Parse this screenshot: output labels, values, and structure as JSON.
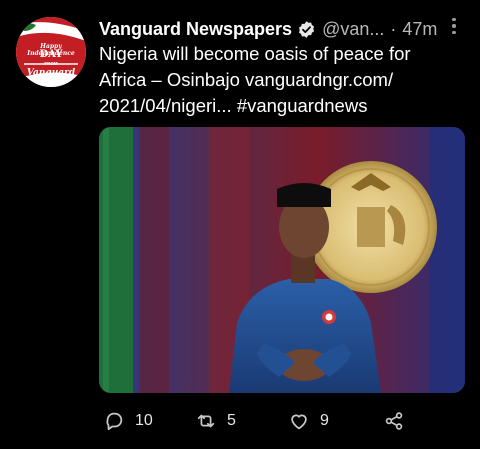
{
  "tweet": {
    "author": {
      "display_name": "Vanguard Newspapers",
      "handle": "@van...",
      "verified": true,
      "avatar": {
        "greeting": "Happy Independence",
        "day": "DAY",
        "from": "FROM",
        "brand": "Vanguard"
      }
    },
    "separator": "·",
    "time": "47m",
    "text_lines": [
      "Nigeria will become oasis of peace for",
      "Africa – Osinbajo vanguardngr.com/",
      "2021/04/nigeri... #vanguardnews"
    ],
    "actions": {
      "replies": "10",
      "retweets": "5",
      "likes": "9"
    },
    "colors": {
      "background": "#000000",
      "secondary_text": "#b8b8b8",
      "icon": "#c8c8c8"
    },
    "icons": {
      "verified": "verified-badge-icon",
      "more": "more-options-icon",
      "reply": "reply-icon",
      "retweet": "retweet-icon",
      "like": "heart-icon",
      "share": "share-icon"
    }
  }
}
